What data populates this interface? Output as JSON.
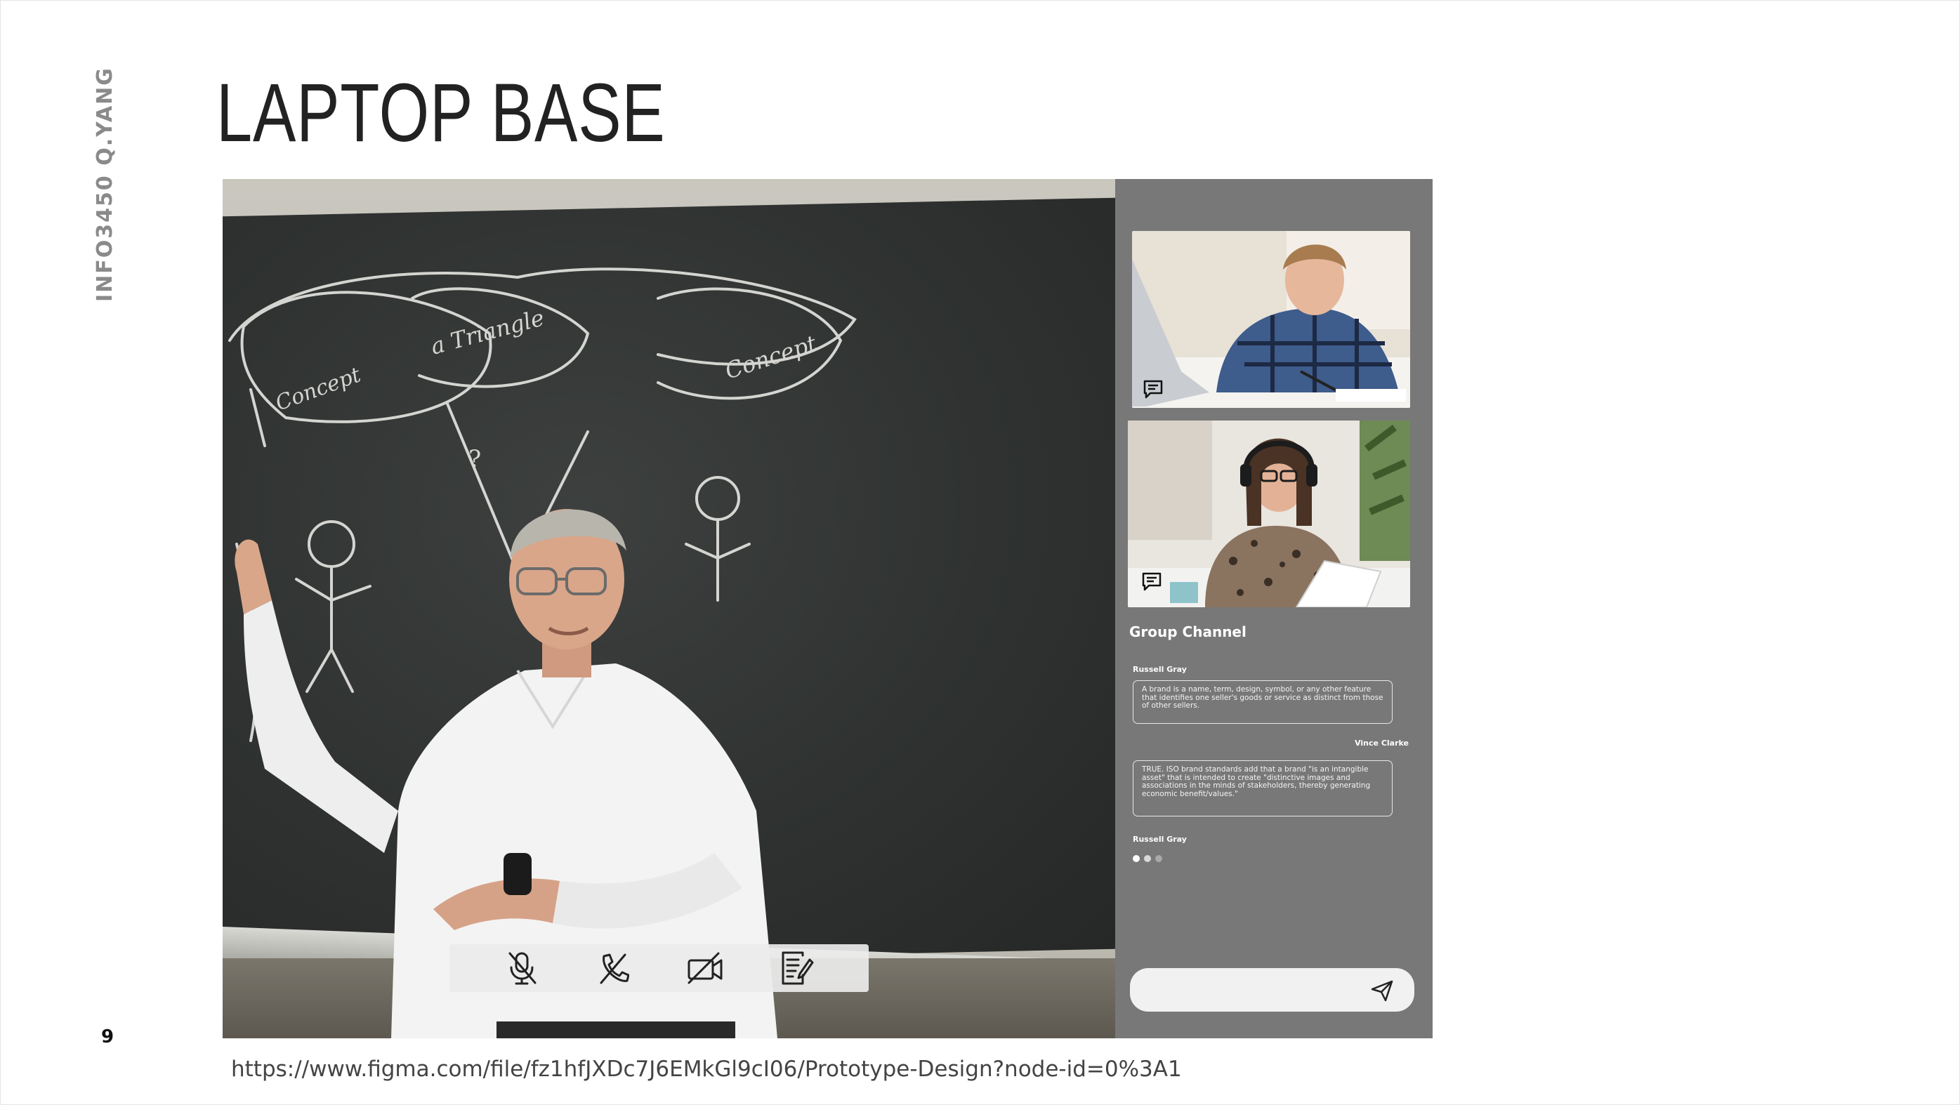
{
  "slide": {
    "side_label": "INFO3450 Q.YANG",
    "title": "LAPTOP BASE",
    "page_number": "9",
    "url": "https://www.figma.com/file/fz1hfJXDc7J6EMkGl9cI06/Prototype-Design?node-id=0%3A1"
  },
  "call_controls": [
    {
      "icon": "mic-off-icon"
    },
    {
      "icon": "hang-up-icon"
    },
    {
      "icon": "camera-off-icon"
    },
    {
      "icon": "notes-edit-icon"
    }
  ],
  "panel": {
    "participants": [
      {
        "icon": "chat-bubble-icon"
      },
      {
        "icon": "chat-bubble-icon"
      }
    ],
    "group_channel_title": "Group Channel",
    "messages": [
      {
        "sender": "Russell Gray",
        "text": "A brand is a name, term, design, symbol, or any other feature that identifies one seller's goods or service as distinct from those of other sellers."
      },
      {
        "sender": "Vince Clarke",
        "text": "TRUE. ISO brand standards add that a brand \"is an intangible asset\" that is intended to create \"distinctive images and associations in the minds of stakeholders, thereby generating economic benefit/values.\""
      }
    ],
    "typing_sender": "Russell Gray",
    "message_input_value": "",
    "send_icon": "send-icon"
  },
  "colors": {
    "panel_bg": "#787878",
    "control_bar_bg": "#ebebeb",
    "typing_dot_active": "#ffffff",
    "typing_dot_inactive": "#bdbdbd"
  }
}
